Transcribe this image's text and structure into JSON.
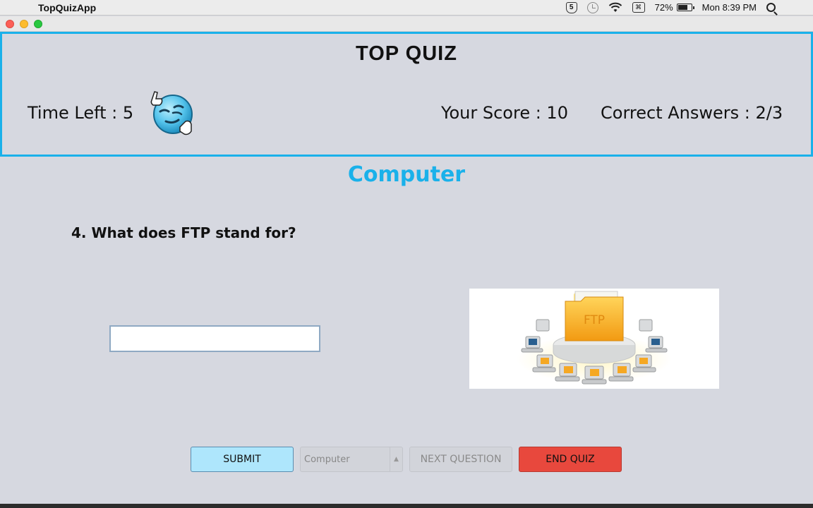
{
  "menubar": {
    "app_name": "TopQuizApp",
    "battery": "72%",
    "clock": "Mon 8:39 PM",
    "icons": [
      "apple-icon",
      "badge-5-icon",
      "time-machine-icon",
      "wifi-icon",
      "keyboard-icon",
      "battery-icon",
      "search-icon",
      "menu-list-icon"
    ],
    "badge_text": "5",
    "keyboard_text": "⌘"
  },
  "header": {
    "title": "TOP QUIZ",
    "time_left": "Time Left : 5",
    "score": "Your Score : 10",
    "correct": "Correct Answers : 2/3"
  },
  "quiz": {
    "category": "Computer",
    "question": "4. What does FTP stand for?",
    "answer_value": "",
    "image_label": "FTP"
  },
  "controls": {
    "submit": "SUBMIT",
    "category_select": "Computer",
    "next": "NEXT QUESTION",
    "end": "END QUIZ"
  },
  "colors": {
    "accent": "#1ab1ea",
    "submit_bg": "#aee6fc",
    "end_bg": "#e8483d",
    "background": "#d6d8e0"
  }
}
